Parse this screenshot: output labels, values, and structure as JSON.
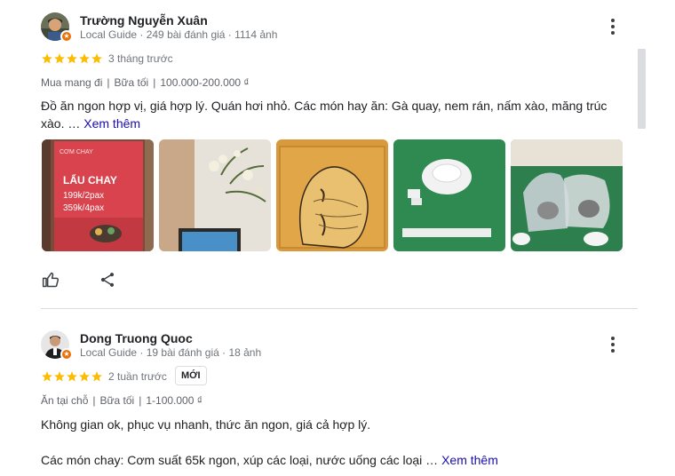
{
  "reviews": [
    {
      "name": "Trường Nguyễn Xuân",
      "meta": "Local Guide · 249 bài đánh giá · 1114 ảnh",
      "rating": 5,
      "when": "3 tháng trước",
      "attributes": [
        "Mua mang đi",
        "Bữa tối",
        "100.000-200.000 ₫"
      ],
      "text": "Đồ ăn ngon hợp vị, giá hợp lý. Quán hơi nhỏ. Các món hay ăn: Gà quay, nem rán, nấm xào, măng trúc xào. …",
      "see_more": "Xem thêm",
      "photos": [
        {
          "icon": "restaurant-sign-photo",
          "sign_title": "LẨU CHAY",
          "sign_line1": "199k/2pax",
          "sign_line2": "359k/4pax",
          "sign_top": "CƠM CHAY"
        },
        {
          "icon": "flower-vase-photo"
        },
        {
          "icon": "buddha-art-photo"
        },
        {
          "icon": "tea-cup-table-photo"
        },
        {
          "icon": "takeaway-bags-photo"
        }
      ]
    },
    {
      "name": "Dong Truong Quoc",
      "meta": "Local Guide · 19 bài đánh giá · 18 ảnh",
      "rating": 5,
      "when": "2 tuần trước",
      "badge": "MỚI",
      "attributes": [
        "Ăn tại chỗ",
        "Bữa tối",
        "1-100.000 ₫"
      ],
      "text_line1": "Không gian ok, phục vụ nhanh, thức ăn ngon, giá cả hợp lý.",
      "text_line2": "Các món chay: Cơm suất 65k ngon, xúp các loại, nước uống các loại …",
      "see_more": "Xem thêm"
    }
  ],
  "colors": {
    "star": "#fbbc04",
    "link": "#1a0dab",
    "guide_badge": "#e8710a"
  },
  "icons": {
    "like": "thumbs-up-icon",
    "share": "share-icon",
    "more": "more-vert-icon"
  }
}
